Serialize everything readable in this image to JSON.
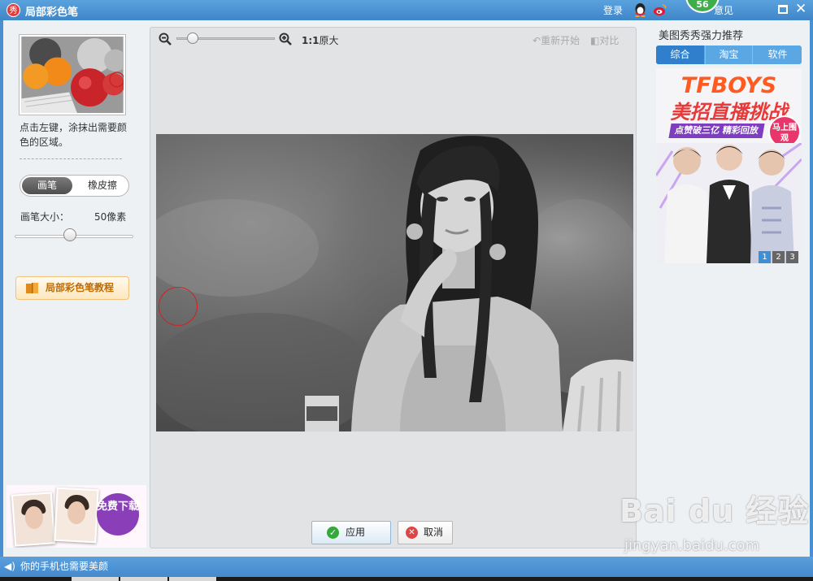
{
  "titlebar": {
    "app_icon": "秀",
    "title": "局部彩色笔",
    "login": "登录",
    "badge": "56",
    "feedback": "意见",
    "close": "✕"
  },
  "left": {
    "hint": "点击左键，涂抹出需要颜色的区域。",
    "mode_brush": "画笔",
    "mode_eraser": "橡皮擦",
    "size_label": "画笔大小：",
    "size_value": "50像素",
    "size_level": 0.5,
    "tutorial": "局部彩色笔教程",
    "ad_download": "免费下载"
  },
  "toolbar": {
    "ratio_bold": "1:1",
    "ratio_text": "原大",
    "restart": "重新开始",
    "compare": "对比"
  },
  "actions": {
    "apply": "应用",
    "cancel": "取消"
  },
  "right": {
    "title": "美图秀秀强力推荐",
    "tabs": [
      "综合",
      "淘宝",
      "软件"
    ],
    "banner_line1": "TFBOYS",
    "banner_line2": "美招直播挑战",
    "banner_line3": "点赞破三亿 精彩回放",
    "banner_badge": "马上围观",
    "pages": [
      "1",
      "2",
      "3"
    ]
  },
  "statusbar": {
    "speaker_icon": "◀)",
    "message": "你的手机也需要美颜"
  },
  "watermark": {
    "brand": "Bai du 经验",
    "url": "jingyan.baidu.com"
  }
}
